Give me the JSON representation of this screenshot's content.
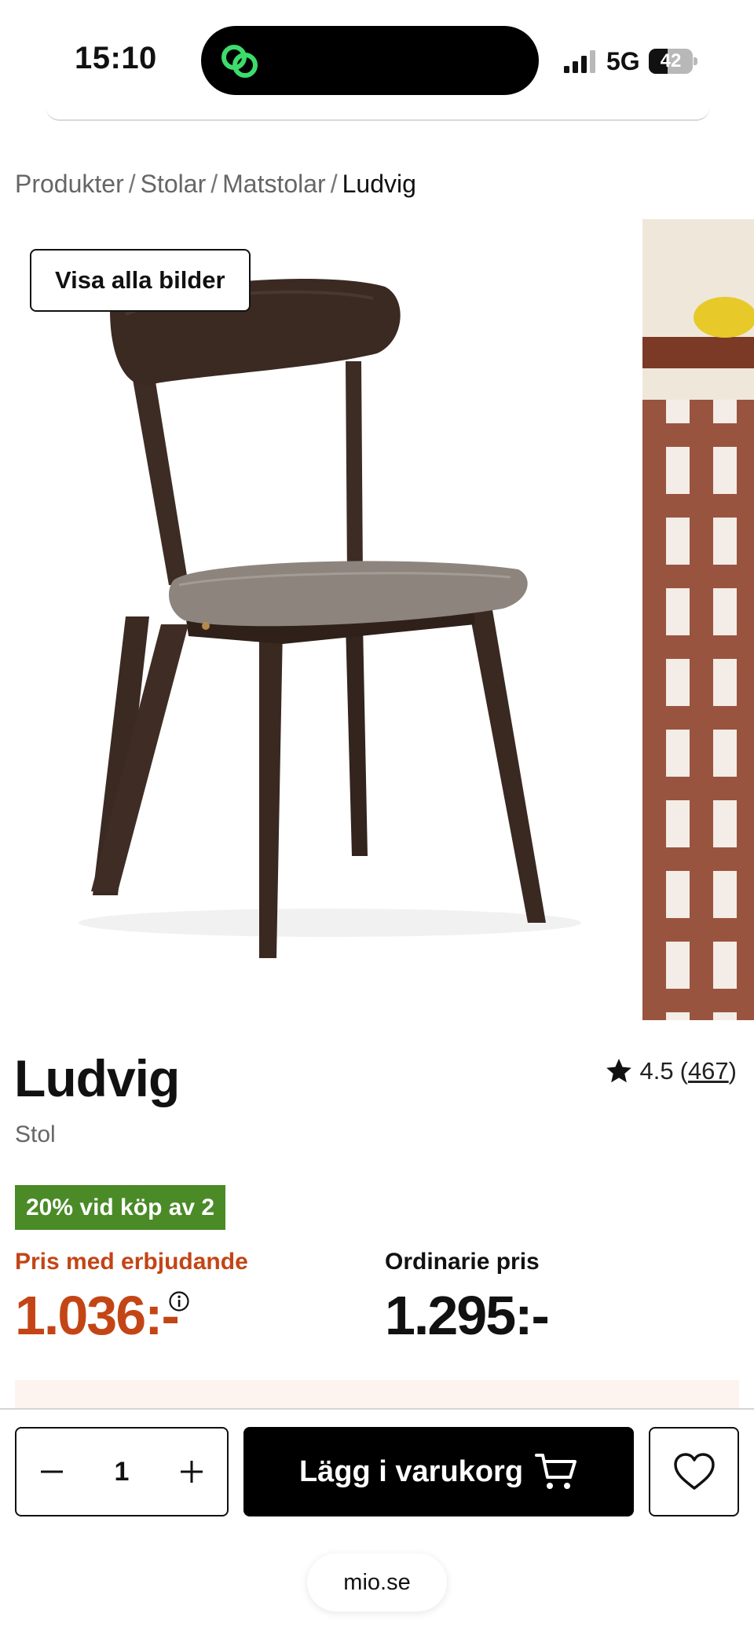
{
  "status_bar": {
    "time": "15:10",
    "network": "5G",
    "battery_level": "42",
    "battery_fraction": 0.42
  },
  "breadcrumb": {
    "items": [
      "Produkter",
      "Stolar",
      "Matstolar"
    ],
    "current": "Ludvig",
    "separator": "/"
  },
  "gallery": {
    "show_all_label": "Visa alla bilder"
  },
  "product": {
    "name": "Ludvig",
    "type": "Stol",
    "rating_value": "4.5",
    "rating_open": "(",
    "rating_count": "467",
    "rating_close": ")",
    "offer_badge": "20% vid köp av 2",
    "offer_price_label": "Pris med erbjudande",
    "offer_price": "1.036:-",
    "regular_price_label": "Ordinarie pris",
    "regular_price": "1.295:-"
  },
  "cart_bar": {
    "quantity": "1",
    "add_to_cart_label": "Lägg i varukorg"
  },
  "browser": {
    "url": "mio.se"
  },
  "colors": {
    "offer": "#c34516",
    "badge": "#4a8a27",
    "button": "#000000"
  }
}
